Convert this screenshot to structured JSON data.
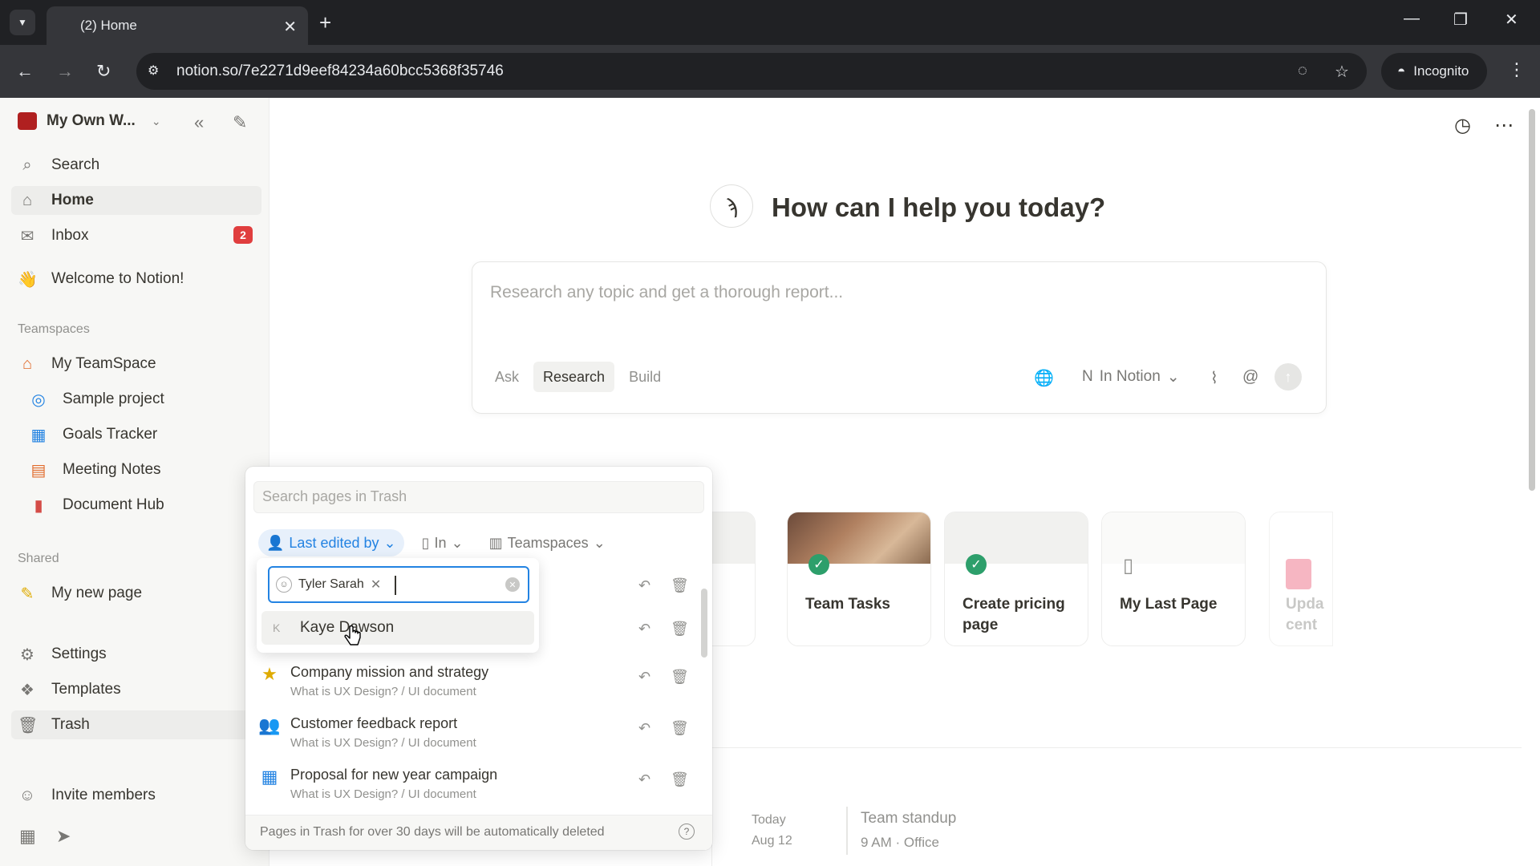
{
  "browser": {
    "tab_title": "(2) Home",
    "url": "notion.so/7e2271d9eef84234a60bcc5368f35746",
    "incognito_label": "Incognito"
  },
  "sidebar": {
    "workspace_name": "My Own W...",
    "nav": [
      {
        "label": "Search",
        "icon": "search-icon"
      },
      {
        "label": "Home",
        "icon": "home-icon"
      },
      {
        "label": "Inbox",
        "icon": "inbox-icon",
        "badge": "2"
      }
    ],
    "welcome": "Welcome to Notion!",
    "teamspaces_label": "Teamspaces",
    "teamspace": "My TeamSpace",
    "teamspace_pages": [
      "Sample project",
      "Goals Tracker",
      "Meeting Notes",
      "Document Hub"
    ],
    "shared_label": "Shared",
    "shared_pages": [
      "My new page"
    ],
    "bottom": [
      "Settings",
      "Templates",
      "Trash"
    ],
    "invite": "Invite members"
  },
  "main": {
    "greeting": "How can I help you today?",
    "composer_placeholder": "Research any topic and get a thorough report...",
    "modes": [
      "Ask",
      "Research",
      "Build"
    ],
    "active_mode": "Research",
    "source_label": "In Notion",
    "cards": [
      {
        "title": "Team Tasks"
      },
      {
        "title": "Create pricing page"
      },
      {
        "title": "My Last Page"
      },
      {
        "title": "Upda cent"
      }
    ],
    "schedule": {
      "day": "Today",
      "date": "Aug 12",
      "event": "Team standup",
      "event_meta": "9 AM · Office"
    }
  },
  "trash": {
    "search_placeholder": "Search pages in Trash",
    "filters": {
      "last_edited": "Last edited by",
      "in": "In",
      "teamspaces": "Teamspaces"
    },
    "rows": [
      {
        "title": "Company mission and strategy",
        "path": "What is UX Design? / UI document",
        "icon": "star-icon"
      },
      {
        "title": "Customer feedback report",
        "path": "What is UX Design? / UI document",
        "icon": "people-icon"
      },
      {
        "title": "Proposal for new year campaign",
        "path": "What is UX Design? / UI document",
        "icon": "calendar-icon"
      }
    ],
    "footer": "Pages in Trash for over 30 days will be automatically deleted"
  },
  "person_filter": {
    "selected_tag": "Tyler Sarah",
    "option": "Kaye Dawson",
    "option_initial": "K"
  },
  "colors": {
    "accent": "#2383e2",
    "badge": "#e03e3e",
    "check": "#2d9f6b"
  }
}
